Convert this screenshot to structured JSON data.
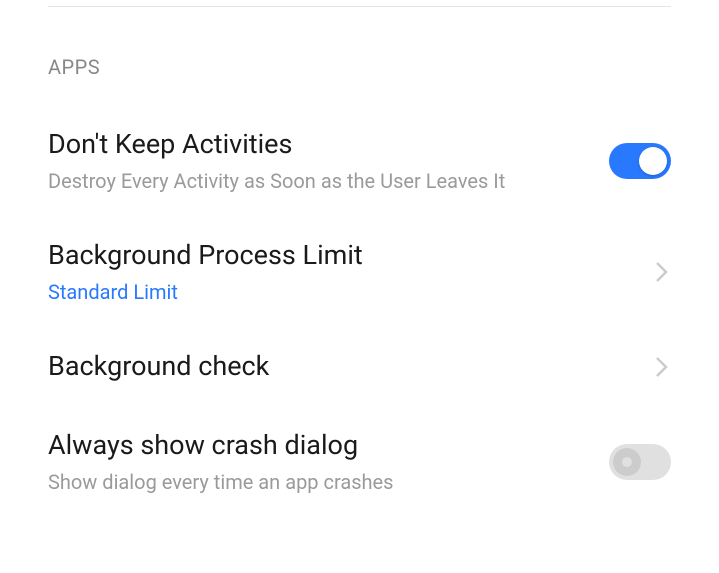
{
  "section": {
    "header": "APPS"
  },
  "settings": {
    "dontKeepActivities": {
      "title": "Don't Keep Activities",
      "subtitle": "Destroy Every Activity as Soon as the User Leaves It",
      "enabled": true
    },
    "backgroundProcessLimit": {
      "title": "Background Process Limit",
      "value": "Standard Limit"
    },
    "backgroundCheck": {
      "title": "Background check"
    },
    "alwaysShowCrashDialog": {
      "title": "Always show crash dialog",
      "subtitle": "Show dialog every time an app crashes",
      "enabled": false
    }
  }
}
